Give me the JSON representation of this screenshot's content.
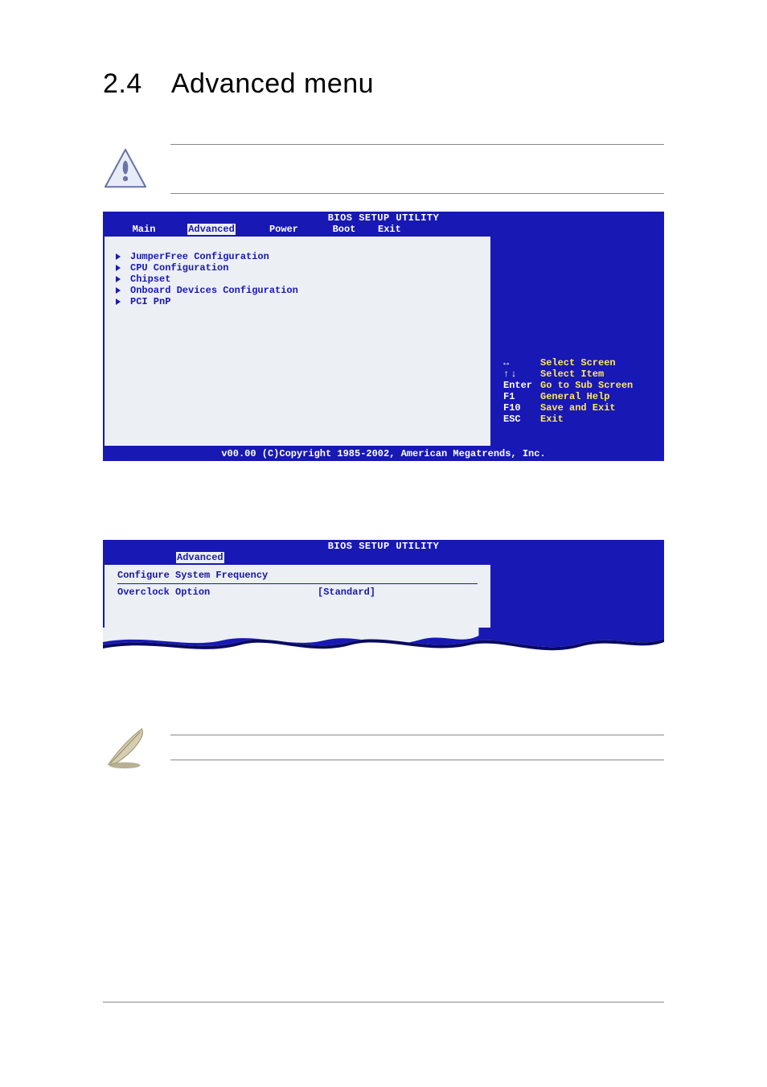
{
  "section": {
    "number": "2.4",
    "title": "Advanced menu"
  },
  "bios1": {
    "title": "BIOS SETUP UTILITY",
    "tabs": [
      "Main",
      "Advanced",
      "Power",
      "Boot",
      "Exit"
    ],
    "selected_tab_index": 1,
    "items": [
      "JumperFree Configuration",
      "CPU Configuration",
      "Chipset",
      "Onboard Devices Configuration",
      "PCI PnP"
    ],
    "help": [
      {
        "key": "↔",
        "label": "Select Screen"
      },
      {
        "key": "↑↓",
        "label": "Select Item"
      },
      {
        "key": "Enter",
        "label": "Go to Sub Screen"
      },
      {
        "key": "F1",
        "label": "General Help"
      },
      {
        "key": "F10",
        "label": "Save and Exit"
      },
      {
        "key": "ESC",
        "label": "Exit"
      }
    ],
    "footer": "v00.00 (C)Copyright 1985-2002, American Megatrends, Inc."
  },
  "bios2": {
    "title": "BIOS SETUP UTILITY",
    "tab": "Advanced",
    "panel_title": "Configure System Frequency",
    "option_label": "Overclock Option",
    "option_value": "[Standard]"
  }
}
